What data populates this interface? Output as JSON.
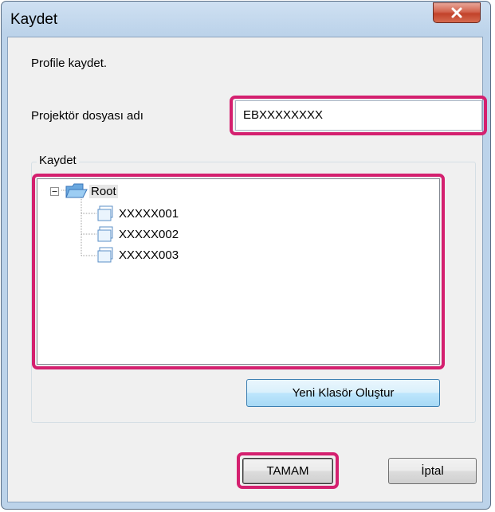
{
  "dialog": {
    "title": "Kaydet",
    "prompt": "Profile kaydet.",
    "file_name_label": "Projektör dosyası adı",
    "file_name_value": "EBXXXXXXXX",
    "group_title": "Kaydet",
    "new_folder_button": "Yeni Klasör Oluştur",
    "ok_button": "TAMAM",
    "cancel_button": "İptal"
  },
  "tree": {
    "root": "Root",
    "children": [
      "XXXXX001",
      "XXXXX002",
      "XXXXX003"
    ]
  },
  "colors": {
    "highlight": "#d4206f",
    "window_frame": "#bcd3ea",
    "close_button": "#c2422a"
  },
  "icons": [
    "close-icon",
    "collapse-icon",
    "folder-icon"
  ]
}
